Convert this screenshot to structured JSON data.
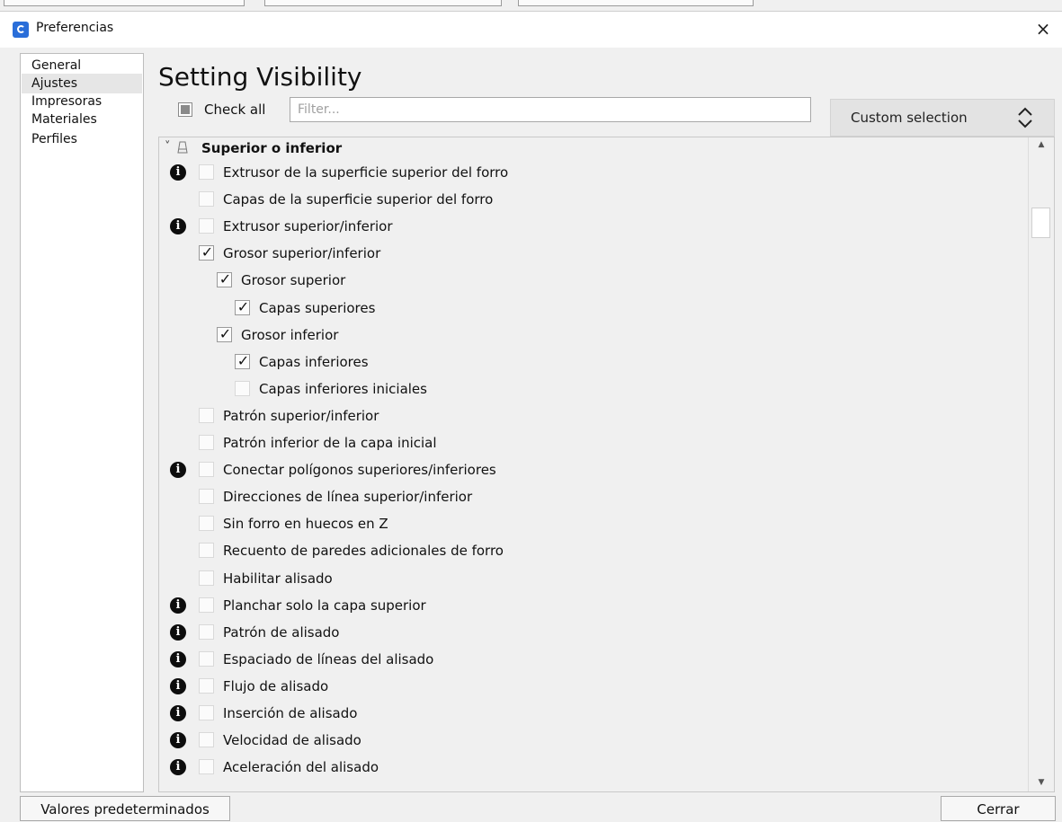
{
  "window": {
    "title": "Preferencias"
  },
  "sidebar": {
    "items": [
      {
        "label": "General"
      },
      {
        "label": "Ajustes"
      },
      {
        "label": "Impresoras"
      },
      {
        "label": "Materiales"
      },
      {
        "label": "Perfiles"
      }
    ],
    "selected": "Ajustes"
  },
  "page": {
    "title": "Setting Visibility"
  },
  "toolbar": {
    "check_all_label": "Check all",
    "filter_placeholder": "Filter...",
    "preset_label": "Custom selection"
  },
  "settings": {
    "category": "Superior o inferior",
    "items": [
      {
        "label": "Extrusor de la superficie superior del forro",
        "checked": false,
        "info": true,
        "level": 0
      },
      {
        "label": "Capas de la superficie superior del forro",
        "checked": false,
        "info": false,
        "level": 0
      },
      {
        "label": "Extrusor superior/inferior",
        "checked": false,
        "info": true,
        "level": 0
      },
      {
        "label": "Grosor superior/inferior",
        "checked": true,
        "info": false,
        "level": 0
      },
      {
        "label": "Grosor superior",
        "checked": true,
        "info": false,
        "level": 1
      },
      {
        "label": "Capas superiores",
        "checked": true,
        "info": false,
        "level": 2
      },
      {
        "label": "Grosor inferior",
        "checked": true,
        "info": false,
        "level": 1
      },
      {
        "label": "Capas inferiores",
        "checked": true,
        "info": false,
        "level": 2
      },
      {
        "label": "Capas inferiores iniciales",
        "checked": false,
        "info": false,
        "level": 2
      },
      {
        "label": "Patrón superior/inferior",
        "checked": false,
        "info": false,
        "level": 0
      },
      {
        "label": "Patrón inferior de la capa inicial",
        "checked": false,
        "info": false,
        "level": 0
      },
      {
        "label": "Conectar polígonos superiores/inferiores",
        "checked": false,
        "info": true,
        "level": 0
      },
      {
        "label": "Direcciones de línea superior/inferior",
        "checked": false,
        "info": false,
        "level": 0
      },
      {
        "label": "Sin forro en huecos en Z",
        "checked": false,
        "info": false,
        "level": 0
      },
      {
        "label": "Recuento de paredes adicionales de forro",
        "checked": false,
        "info": false,
        "level": 0
      },
      {
        "label": "Habilitar alisado",
        "checked": false,
        "info": false,
        "level": 0
      },
      {
        "label": "Planchar solo la capa superior",
        "checked": false,
        "info": true,
        "level": 0
      },
      {
        "label": "Patrón de alisado",
        "checked": false,
        "info": true,
        "level": 0
      },
      {
        "label": "Espaciado de líneas del alisado",
        "checked": false,
        "info": true,
        "level": 0
      },
      {
        "label": "Flujo de alisado",
        "checked": false,
        "info": true,
        "level": 0
      },
      {
        "label": "Inserción de alisado",
        "checked": false,
        "info": true,
        "level": 0
      },
      {
        "label": "Velocidad de alisado",
        "checked": false,
        "info": true,
        "level": 0
      },
      {
        "label": "Aceleración del alisado",
        "checked": false,
        "info": true,
        "level": 0
      }
    ]
  },
  "footer": {
    "defaults_label": "Valores predeterminados",
    "close_label": "Cerrar"
  },
  "icons": {
    "info": "info-icon",
    "check": "✓",
    "info_glyph": "i",
    "close": "×"
  }
}
